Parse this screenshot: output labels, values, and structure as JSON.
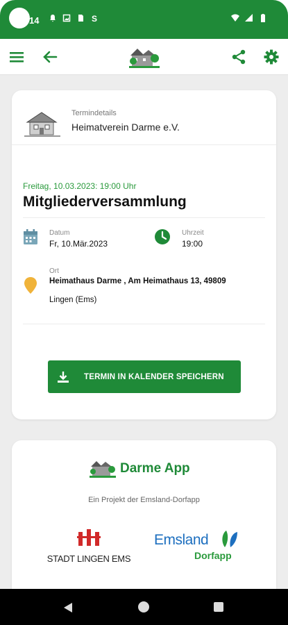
{
  "status_bar": {
    "time": "14",
    "bg_color": "#1f8a38",
    "icons_left": [
      "bell-icon",
      "photo-icon",
      "sim-icon",
      "s-icon"
    ],
    "icons_right": [
      "wifi-icon",
      "signal-icon",
      "battery-icon"
    ]
  },
  "app_bar": {
    "menu_icon": "menu-icon",
    "back_icon": "arrow-left-icon",
    "logo": "village-logo",
    "share_icon": "share-icon",
    "settings_icon": "gear-icon",
    "accent": "#1f8a38"
  },
  "event_card": {
    "organizer_label": "Termindetails",
    "organizer_name": "Heimatverein Darme e.V.",
    "datetime": "Freitag, 10.03.2023: 19:00 Uhr",
    "title": "Mitgliederversammlung",
    "date_label": "Datum",
    "date_value": "Fr, 10.Mär.2023",
    "time_label": "Uhrzeit",
    "time_value": "19:00",
    "location_label": "Ort",
    "location_line1": "Heimathaus Darme , Am Heimathaus 13, 49809",
    "location_line2": "Lingen (Ems)",
    "save_button": "TERMIN IN KALENDER SPEICHERN"
  },
  "app_card": {
    "app_name": "Darme App",
    "subtitle": "Ein Projekt der Emsland-Dorfapp",
    "partner1": "STADT LINGEN EMS",
    "partner2_title": "Emsland",
    "partner2_sub": "Dorfapp"
  }
}
